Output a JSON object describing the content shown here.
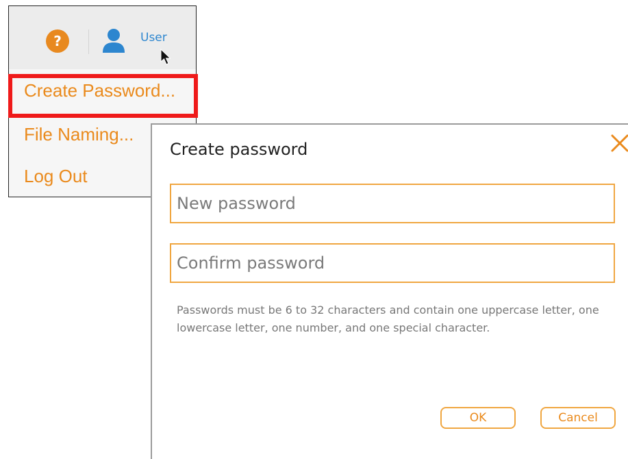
{
  "menu": {
    "user_label": "User",
    "items": [
      {
        "label": "Create Password..."
      },
      {
        "label": "File Naming..."
      },
      {
        "label": "Log Out"
      }
    ]
  },
  "dialog": {
    "title": "Create password",
    "new_password_placeholder": "New password",
    "confirm_password_placeholder": "Confirm password",
    "hint": "Passwords must be 6 to 32 characters and contain one uppercase letter, one lowercase letter, one number, and one special character.",
    "ok_label": "OK",
    "cancel_label": "Cancel"
  },
  "colors": {
    "accent": "#ea8a1c",
    "highlight": "#ef1a1a",
    "user_blue": "#2d86cf"
  },
  "icons": [
    "help-icon",
    "user-icon",
    "cursor-icon",
    "close-icon"
  ]
}
